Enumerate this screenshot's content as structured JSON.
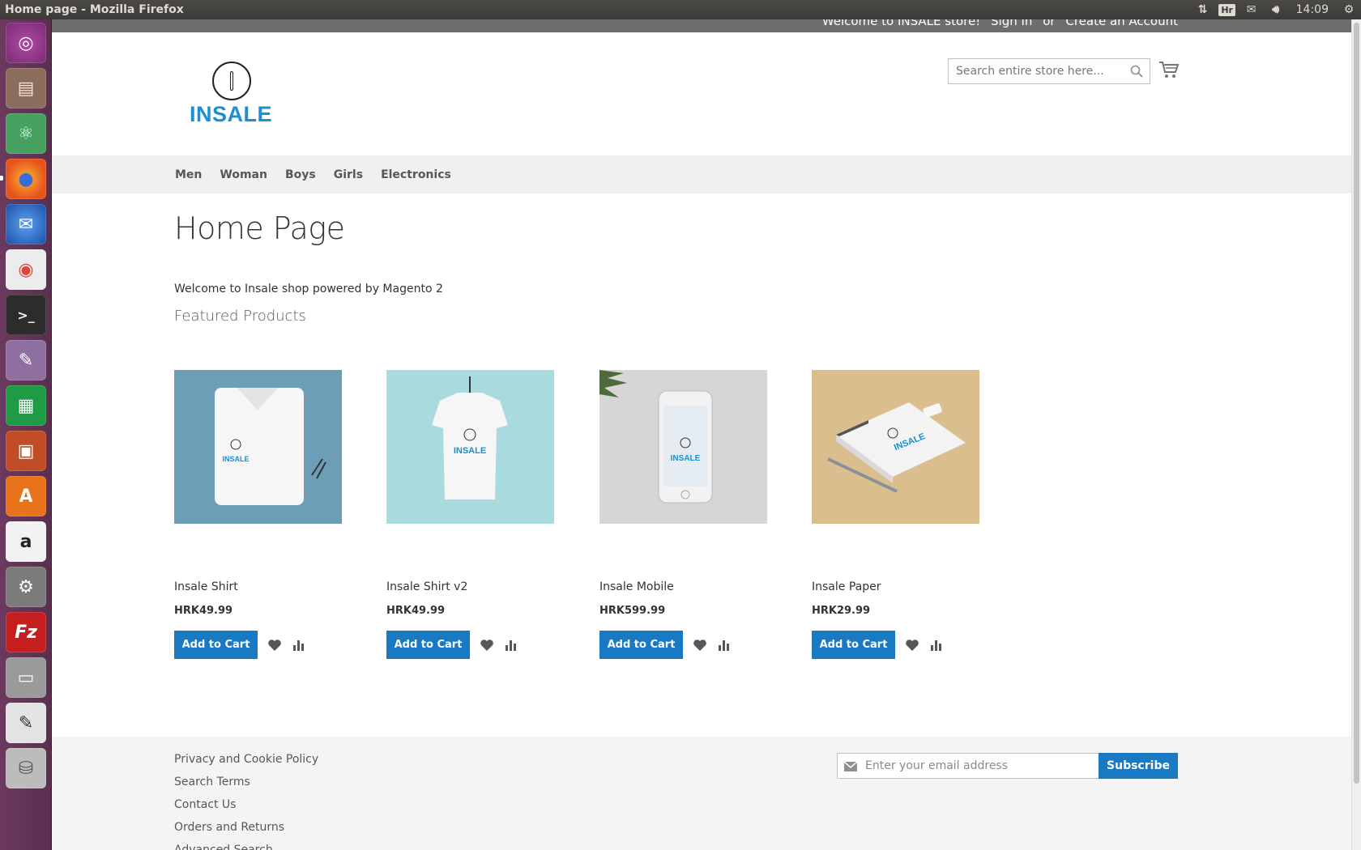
{
  "window": {
    "title": "Home page - Mozilla Firefox"
  },
  "system": {
    "keyboard_layout": "Hr",
    "time": "14:09"
  },
  "launcher": {
    "apps": [
      "ubuntu-dash",
      "files",
      "atom",
      "firefox",
      "thunderbird",
      "chrome",
      "terminal",
      "gimp",
      "calc",
      "impress",
      "software-center",
      "amazon",
      "system-settings",
      "filezilla",
      "scanner",
      "text-editor",
      "disks"
    ]
  },
  "header": {
    "welcome": "Welcome to INSALE store!",
    "sign_in": "Sign In",
    "or": "or",
    "create_account": "Create an Account",
    "logo_text": "INSALE",
    "search_placeholder": "Search entire store here..."
  },
  "nav": {
    "items": [
      "Men",
      "Woman",
      "Boys",
      "Girls",
      "Electronics"
    ]
  },
  "main": {
    "page_title": "Home Page",
    "welcome_text": "Welcome to Insale shop powered by Magento 2",
    "featured_heading": "Featured Products"
  },
  "products": [
    {
      "name": "Insale Shirt",
      "price": "HRK49.99",
      "add_label": "Add to Cart",
      "bg": "#6c9eb8"
    },
    {
      "name": "Insale Shirt v2",
      "price": "HRK49.99",
      "add_label": "Add to Cart",
      "bg": "#a9dade"
    },
    {
      "name": "Insale Mobile",
      "price": "HRK599.99",
      "add_label": "Add to Cart",
      "bg": "#d7d5d6"
    },
    {
      "name": "Insale Paper",
      "price": "HRK29.99",
      "add_label": "Add to Cart",
      "bg": "#dbbe8e"
    }
  ],
  "footer": {
    "links": [
      "Privacy and Cookie Policy",
      "Search Terms",
      "Contact Us",
      "Orders and Returns",
      "Advanced Search"
    ],
    "newsletter_placeholder": "Enter your email address",
    "subscribe_label": "Subscribe"
  },
  "colors": {
    "accent": "#1979c3",
    "logo": "#1b8fd1",
    "nav_bg": "#f0f0f0",
    "footer_bg": "#f4f4f4"
  }
}
